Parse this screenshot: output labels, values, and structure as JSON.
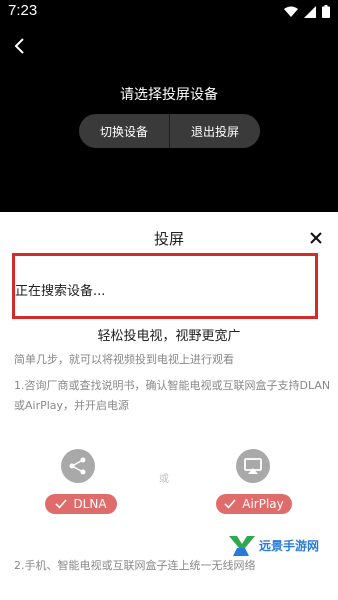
{
  "status": {
    "time": "7:23"
  },
  "header": {
    "title": "请选择投屏设备",
    "switch_label": "切换设备",
    "exit_label": "退出投屏"
  },
  "sheet": {
    "title": "投屏",
    "searching_text": "正在搜索设备...",
    "headline": "轻松投电视，视野更宽广",
    "desc": "简单几步，就可以将视频投到电视上进行观看",
    "step1": "1.咨询厂商或查找说明书，确认智能电视或互联网盒子支持DLAN或AirPlay，并开启电源",
    "or_text": "或",
    "dlna_label": "DLNA",
    "airplay_label": "AirPlay",
    "step2": "2.手机、智能电视或互联网盒子连上统一无线网络"
  },
  "watermark": {
    "text": "远景手游网"
  },
  "colors": {
    "accent": "#d42a2a",
    "pill": "#e06b6b"
  }
}
